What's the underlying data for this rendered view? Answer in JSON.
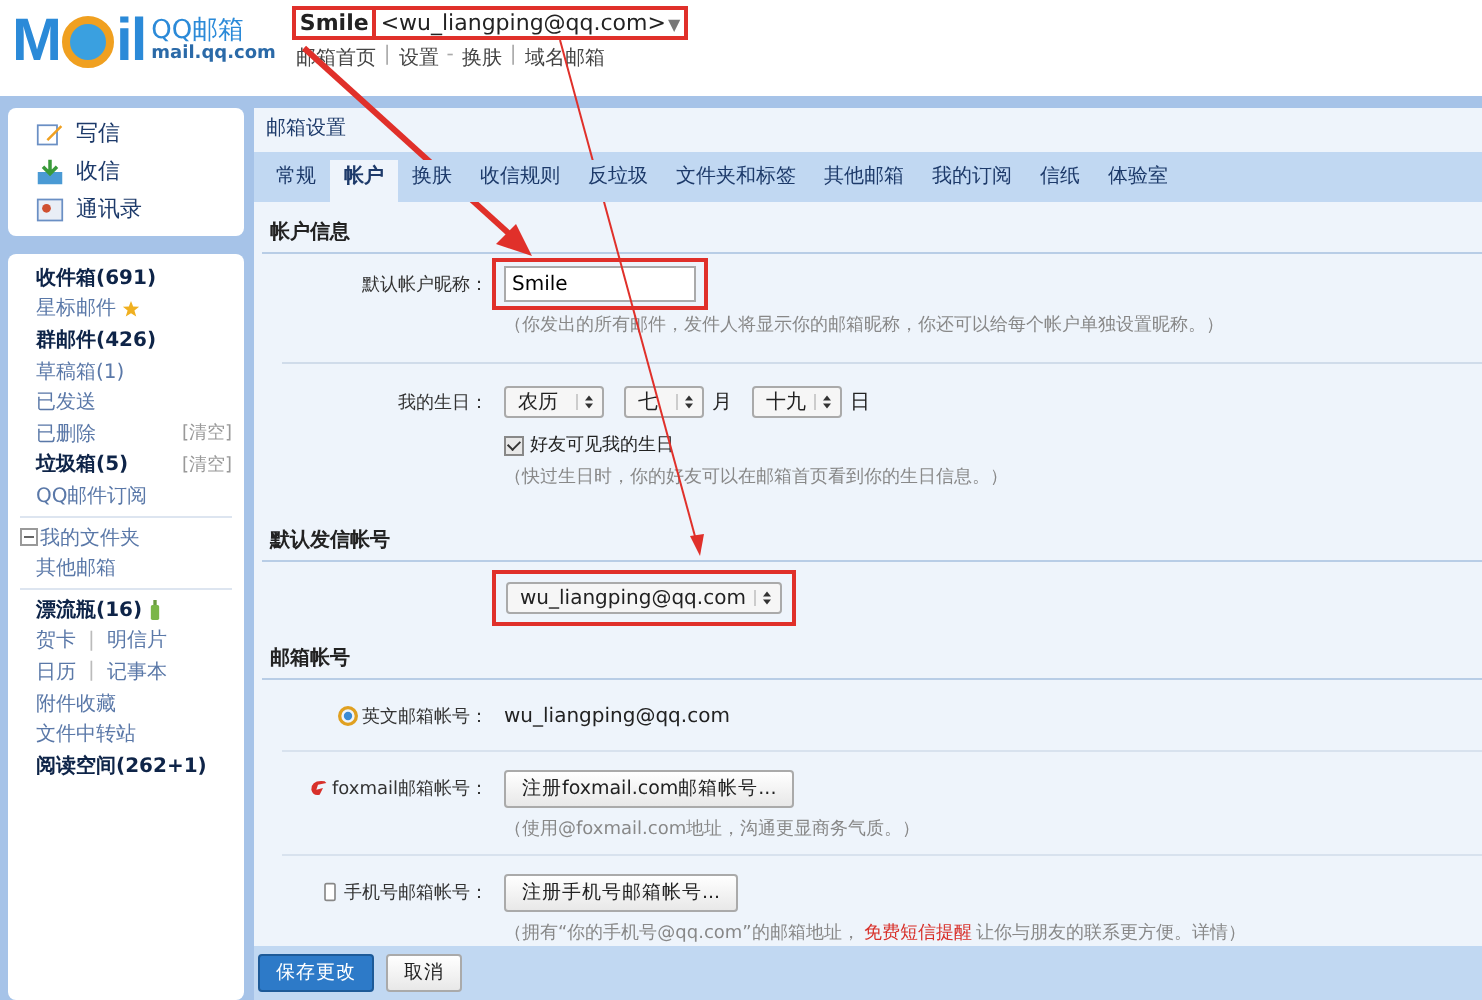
{
  "header": {
    "logo_word": "M",
    "logo_rest": "il",
    "brand": "QQ邮箱",
    "domain": "mail.qq.com",
    "nickname": {
      "text": "Smile",
      "highlighted": true
    },
    "address": {
      "text": "<wu_liangping@qq.com>",
      "highlighted": true
    },
    "caret": "▼",
    "links": [
      {
        "label": "邮箱首页",
        "sep": "|"
      },
      {
        "label": "设置",
        "sep": "-"
      },
      {
        "label": "换肤",
        "sep": "|"
      },
      {
        "label": "域名邮箱"
      }
    ]
  },
  "sidebar": {
    "actions": [
      {
        "label": "写信",
        "kind": "write"
      },
      {
        "label": "收信",
        "kind": "receive"
      },
      {
        "label": "通讯录",
        "kind": "contacts"
      }
    ],
    "groups": [
      [
        {
          "label": "收件箱(691)",
          "bold": true
        },
        {
          "label": "星标邮件",
          "kind": "starred",
          "bold": false
        },
        {
          "label": "群邮件(426)",
          "bold": true
        },
        {
          "label": "草稿箱(1)",
          "bold": false
        },
        {
          "label": "已发送",
          "bold": false
        },
        {
          "label": "已删除",
          "bold": false,
          "action": "[清空]"
        },
        {
          "label": "垃圾箱(5)",
          "bold": true,
          "action": "[清空]"
        },
        {
          "label": "QQ邮件订阅",
          "bold": false
        }
      ],
      [
        {
          "label": "我的文件夹",
          "bold": false,
          "expanded": true
        },
        {
          "label": "其他邮箱",
          "bold": false
        }
      ],
      [
        {
          "label": "漂流瓶(16)",
          "bold": true,
          "kind": "bottle"
        },
        {
          "links": [
            "贺卡",
            "明信片"
          ],
          "sep": "|"
        },
        {
          "links": [
            "日历",
            "记事本"
          ],
          "sep": "|"
        },
        {
          "label": "附件收藏",
          "bold": false
        },
        {
          "label": "文件中转站",
          "bold": false
        },
        {
          "label": "阅读空间(262+1)",
          "bold": true
        }
      ]
    ]
  },
  "main": {
    "title": "邮箱设置",
    "tabs": [
      {
        "label": "常规",
        "selected": false
      },
      {
        "label": "帐户",
        "selected": true
      },
      {
        "label": "换肤",
        "selected": false
      },
      {
        "label": "收信规则",
        "selected": false
      },
      {
        "label": "反垃圾",
        "selected": false
      },
      {
        "label": "文件夹和标签",
        "selected": false
      },
      {
        "label": "其他邮箱",
        "selected": false
      },
      {
        "label": "我的订阅",
        "selected": false
      },
      {
        "label": "信纸",
        "selected": false
      },
      {
        "label": "体验室",
        "selected": false
      }
    ],
    "account_info": {
      "heading": "帐户信息",
      "nickname_label": "默认帐户昵称：",
      "nickname_value": "Smile",
      "nickname_highlighted": true,
      "nickname_hint": "（你发出的所有邮件，发件人将显示你的邮箱昵称，你还可以给每个帐户单独设置昵称。）",
      "birthday_label": "我的生日：",
      "calendar": "农历",
      "month": "七",
      "month_unit": "月",
      "day": "十九",
      "day_unit": "日",
      "friends_visible": {
        "label": "好友可见我的生日",
        "checked": true
      },
      "birthday_hint": "（快过生日时，你的好友可以在邮箱首页看到你的生日信息。）"
    },
    "default_sender": {
      "heading": "默认发信帐号",
      "value": "wu_liangping@qq.com",
      "highlighted": true
    },
    "accounts": {
      "heading": "邮箱帐号",
      "rows": [
        {
          "kind": "text",
          "label": "英文邮箱帐号：",
          "value": "wu_liangping@qq.com"
        },
        {
          "kind": "button",
          "label": "foxmail邮箱帐号：",
          "button": "注册foxmail.com邮箱帐号...",
          "hint": "（使用@foxmail.com地址，沟通更显商务气质。）"
        },
        {
          "kind": "button",
          "label": "手机号邮箱帐号：",
          "button": "注册手机号邮箱帐号...",
          "hint": "（拥有“你的手机号@qq.com”的邮箱地址，",
          "hint_link": "免费短信提醒",
          "hint_tail": "让你与朋友的联系更方便。详情）"
        }
      ]
    },
    "footer": {
      "save": "保存更改",
      "cancel": "取消"
    }
  }
}
